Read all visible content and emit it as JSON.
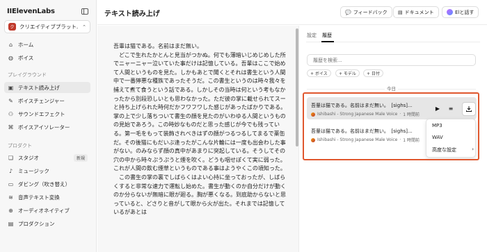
{
  "app": {
    "logo": "IIElevenLabs"
  },
  "workspace": {
    "avatar": "ク",
    "label": "クリエイティブプラット..."
  },
  "sidebar": {
    "top": [
      {
        "label": "ホーム",
        "icon": "home-icon"
      },
      {
        "label": "ボイス",
        "icon": "voice-icon"
      }
    ],
    "playground_title": "プレイグラウンド",
    "playground": [
      {
        "label": "テキスト読み上げ",
        "icon": "tts-icon",
        "active": true
      },
      {
        "label": "ボイスチェンジャー",
        "icon": "voice-changer-icon"
      },
      {
        "label": "サウンドエフェクト",
        "icon": "sound-effects-icon"
      },
      {
        "label": "ボイスアイソレーター",
        "icon": "voice-isolator-icon"
      }
    ],
    "products_title": "プロダクト",
    "products": [
      {
        "label": "スタジオ",
        "icon": "studio-icon",
        "badge": "新規"
      },
      {
        "label": "ミュージック",
        "icon": "music-icon"
      },
      {
        "label": "ダビング（吹き替え）",
        "icon": "dubbing-icon"
      },
      {
        "label": "音声テキスト変換",
        "icon": "speech-to-text-icon"
      },
      {
        "label": "オーディオネイティブ",
        "icon": "audio-native-icon"
      },
      {
        "label": "プロダクション",
        "icon": "productions-icon"
      }
    ]
  },
  "header": {
    "title": "テキスト読み上げ",
    "feedback": "フィードバック",
    "docs": "ドキュメント",
    "talk": "Elと話す"
  },
  "editor": {
    "text": "吾輩は猫である。名前はまだ無い。\n　どこで生れたかとんと見当がつかぬ。何でも薄暗いじめじめした所でニャーニャー泣いていた事だけは記憶している。吾輩はここで始めて人間というものを見た。しかもあとで聞くとそれは書生という人間中で一番獰悪な種族であったそうだ。この書生というのは時々我々を捕えて煮て食うという話である。しかしその当時は何という考もなかったから別段恐しいとも思わなかった。ただ彼の掌に載せられてスーと持ち上げられた時何だかフワフワした感じがあったばかりである。掌の上で少し落ちついて書生の顔を見たのがいわゆる人間というものの見始であろう。この時妙なものだと思った感じが今でも残っている。第一毛をもって装飾されべきはずの顔がつるつるしてまるで薬缶だ。その後猫にもだいぶ逢ったがこんな片輪には一度も出会わした事がない。のみならず顔の真中があまりに突起している。そうしてその穴の中から時々ぷうぷうと煙を吹く。どうも咽せぽくて実に弱った。これが人間の飲む煙草というものである事はようやくこの頃知った。\n　この書生の掌の裏でしばらくはよい心持に坐っておったが、しばらくすると非常な速力で運転し始めた。書生が動くのか自分だけが動くのか分らないが無暗に眼が廻る。胸が悪くなる。到底助からないと思っていると、どさりと音がして眼から火が出た。それまでは記憶しているがあとは"
  },
  "panel": {
    "tabs": [
      "設定",
      "履歴"
    ],
    "active_tab": "履歴",
    "search_placeholder": "履歴を検索...",
    "filters": [
      "+ ボイス",
      "+ モデル",
      "+ 日付"
    ],
    "date_group": "今日",
    "history": [
      {
        "text": "吾輩は猫である。名前はまだ無い。　[sighs]...",
        "voice": "Ishibashi - Strong Japanese Male Voice",
        "time": "1 時間前"
      },
      {
        "text": "吾輩は猫である。名前はまだ無い。　[sighs]...",
        "voice": "Ishibashi - Strong Japanese Male Voice",
        "time": "1 時間前"
      }
    ],
    "download_menu": [
      "MP3",
      "WAV",
      "高度な設定"
    ]
  },
  "colors": {
    "highlight": "#e0572e",
    "accent": "#111111"
  }
}
